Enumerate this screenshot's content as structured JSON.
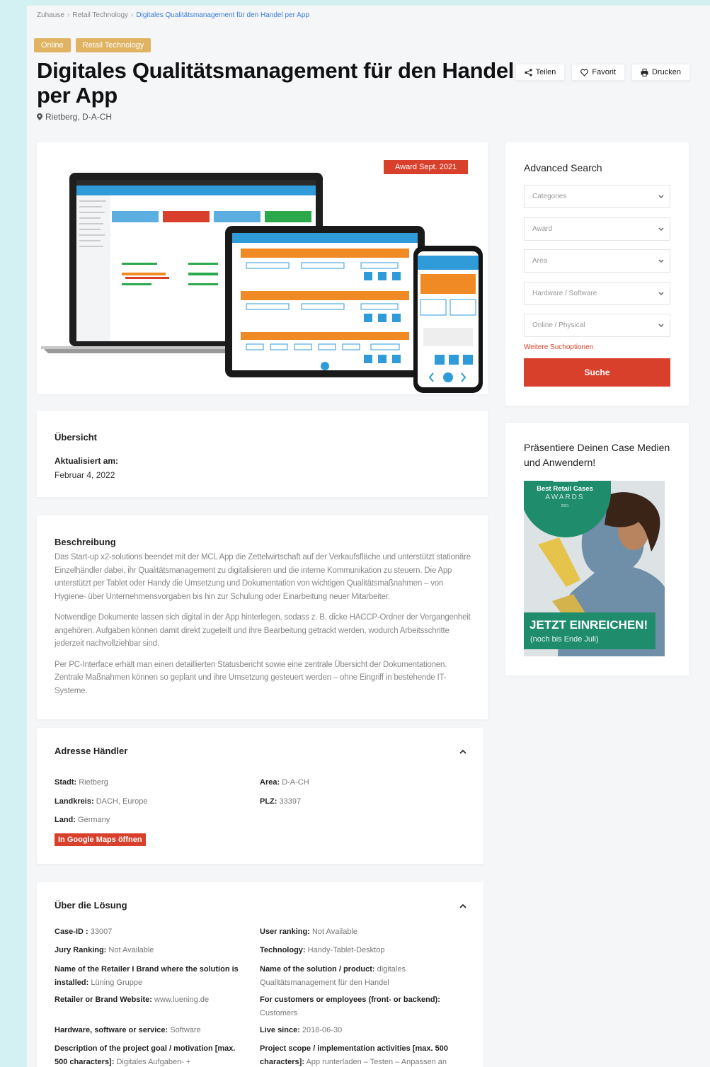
{
  "breadcrumb": {
    "home": "Zuhause",
    "category": "Retail Technology",
    "current": "Digitales Qualitätsmanagement für den Handel per App"
  },
  "badges": [
    "Online",
    "Retail Technology"
  ],
  "title": "Digitales Qualitätsmanagement für den Handel per App",
  "location": "Rietberg, D-A-CH",
  "actions": {
    "share": "Teilen",
    "favorite": "Favorit",
    "print": "Drucken"
  },
  "hero": {
    "award": "Award Sept. 2021"
  },
  "overview": {
    "heading": "Übersicht",
    "updated_label": "Aktualisiert am:",
    "updated_value": "Februar 4, 2022"
  },
  "description": {
    "heading": "Beschreibung",
    "paragraphs": [
      "Das Start-up x2-solutions beendet mit der MCL App die Zettelwirtschaft auf der Verkaufsfläche und unterstützt stationäre Einzelhändler dabei, ihr Qualitätsmanagement zu digitalisieren und die interne Kommunikation zu steuern. Die App unterstützt per Tablet oder Handy die Umsetzung und Dokumentation von wichtigen Qualitätsmaßnahmen – von Hygiene- über Unternehmensvorgaben bis hin zur Schulung oder Einarbeitung neuer Mitarbeiter.",
      "Notwendige Dokumente lassen sich digital in der App hinterlegen, sodass z. B. dicke HACCP-Ordner der Vergangenheit angehören. Aufgaben können damit direkt zugeteilt und ihre Bearbeitung getrackt werden, wodurch Arbeitsschritte jederzeit nachvollziehbar sind.",
      "Per PC-Interface erhält man einen detaillierten Statusbericht sowie eine zentrale Übersicht der Dokumentationen. Zentrale Maßnahmen können so geplant und ihre Umsetzung gesteuert werden – ohne Eingriff in bestehende IT-Systeme."
    ]
  },
  "address": {
    "heading": "Adresse Händler",
    "city_label": "Stadt:",
    "city": "Rietberg",
    "area_label": "Area:",
    "area": "D-A-CH",
    "district_label": "Landkreis:",
    "district": "DACH, Europe",
    "zip_label": "PLZ:",
    "zip": "33397",
    "country_label": "Land:",
    "country": "Germany",
    "maps_button": "In Google Maps öffnen"
  },
  "solution": {
    "heading": "Über die Lösung",
    "case_id_label": "Case-ID :",
    "case_id": "33007",
    "user_ranking_label": "User ranking:",
    "user_ranking": "Not Available",
    "jury_label": "Jury Ranking:",
    "jury": "Not Available",
    "technology_label": "Technology:",
    "technology": "Handy-Tablet-Desktop",
    "retailer_label": "Name of the Retailer I Brand where the solution is installed:",
    "retailer": "Lüning Gruppe",
    "product_label": "Name of the solution / product:",
    "product": "digitales Qualitätsmanagement für den Handel",
    "website_label": "Retailer or Brand Website:",
    "website": "www.luening.de",
    "customers_label": "For customers or employees (front- or backend):",
    "customers": "Customers",
    "hw_label": "Hardware, software or service:",
    "hw": "Software",
    "live_label": "Live since:",
    "live": "2018-06-30",
    "goal_label": "Description of the project goal / motivation [max. 500 characters]:",
    "goal": "Digitales Aufgaben- +",
    "scope_label": "Project scope / implementation activities [max. 500 characters]:",
    "scope": "App runterladen – Testen – Anpassen an"
  },
  "search": {
    "heading": "Advanced Search",
    "selects": [
      "Categories",
      "Award",
      "Area",
      "Hardware / Software",
      "Online / Physical"
    ],
    "more": "Weitere Suchoptionen",
    "button": "Suche"
  },
  "promo": {
    "title": "Präsentiere Deinen Case Medien und Anwendern!",
    "logo_line1": "Best Retail Cases",
    "logo_line2": "AWARDS",
    "logo_line3": "2021",
    "band_line1": "JETZT EINREICHEN!",
    "band_line2": "(noch bis Ende Juli)"
  },
  "colors": {
    "accent": "#d9402c",
    "badge": "#e0b363",
    "green": "#1f8c6c",
    "link": "#3b7dd8"
  }
}
